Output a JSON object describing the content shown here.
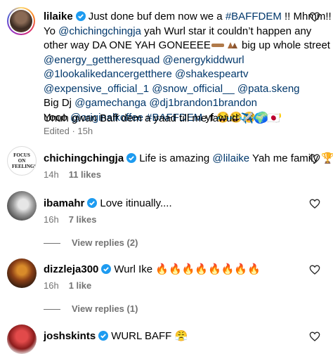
{
  "colors": {
    "mention": "#00376b",
    "meta": "#737373",
    "verified": "#1d9bf0"
  },
  "comment1": {
    "username": "lilaike",
    "first_text": "Just done buf dem now we a ",
    "first_tag": "#BAFFDEM",
    "first_tail": " !! Mhmm!!",
    "line2": "Yo ",
    "line2_mention": "@chichingchingja",
    "line2_tail": " yah Wurl star it couldn’t happen any",
    "line3": "other way DA ONE YAH GONEEEE",
    "line3_tail": " big up whole street",
    "line4": "@energy_gettheresquad @energykiddwurl",
    "line5": "@1lookalikedancergetthere @shakespeartv",
    "line6": "@expensive_official_1 @snow_official__ @pata.skeng",
    "line7_prefix": "Big Dj ",
    "line7_mentions": "@gamechanga @dj1brandon1brandon",
    "line8_prefix": "Yooo ",
    "line8_mention": "@originalkoffee",
    "line8_tag": " #BAFFDEM",
    "line8_tail": " yf 😂😂😂🌍🤝",
    "line9": "Unuh gwan Baff dem a yaad till me fawud ✈️🌍🇯🇵",
    "meta": "Edited · 15h"
  },
  "comment2": {
    "username": "chichingchingja",
    "text": "Life is amazing ",
    "mention": "@lilaike",
    "tail": " Yah me family 🏆",
    "time": "14h",
    "likes": "11 likes"
  },
  "comment3": {
    "username": "ibamahr",
    "text": "Love itinually....",
    "time": "16h",
    "likes": "7 likes",
    "view_replies": "View replies (2)"
  },
  "comment4": {
    "username": "dizzleja300",
    "text": "Wurl Ike 🔥🔥🔥🔥🔥🔥🔥🔥",
    "time": "16h",
    "likes": "1 like",
    "view_replies": "View replies (1)"
  },
  "comment5": {
    "username": "joshskints",
    "text": "WURL BAFF 😤"
  }
}
